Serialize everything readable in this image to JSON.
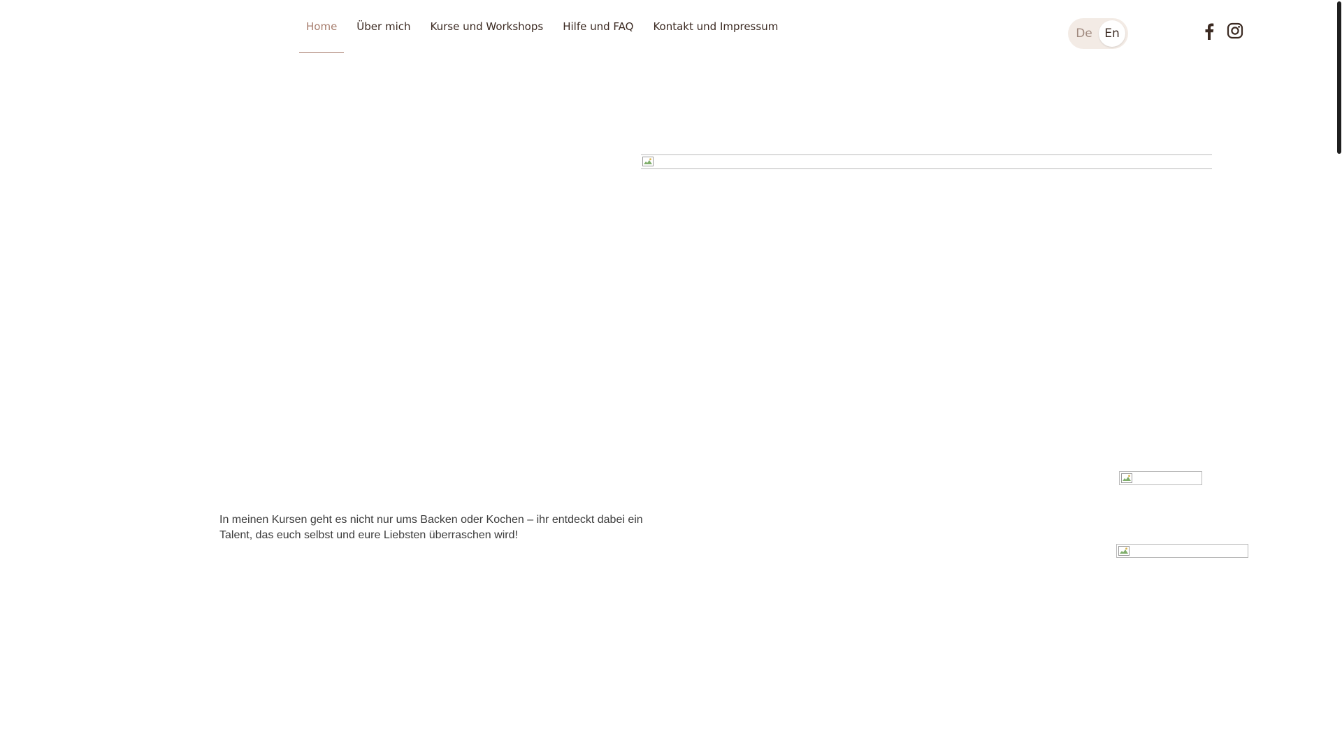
{
  "nav": {
    "items": [
      {
        "label": "Home",
        "active": true
      },
      {
        "label": "Über mich"
      },
      {
        "label": "Kurse und Workshops"
      },
      {
        "label": "Hilfe und FAQ"
      },
      {
        "label": "Kontakt und Impressum"
      }
    ]
  },
  "language": {
    "options": [
      "De",
      "En"
    ],
    "selected": "En"
  },
  "social": {
    "icons": [
      "facebook-icon",
      "instagram-icon"
    ]
  },
  "hero": {
    "text": "In meinen Kursen geht es nicht nur ums Backen oder Kochen – ihr entdeckt dabei ein Talent, das euch selbst und eure Liebsten überraschen wird!"
  },
  "colors": {
    "accent": "#a67c6c",
    "nav_text": "#3b2a22",
    "toggle_bg": "#f3ebe5"
  }
}
